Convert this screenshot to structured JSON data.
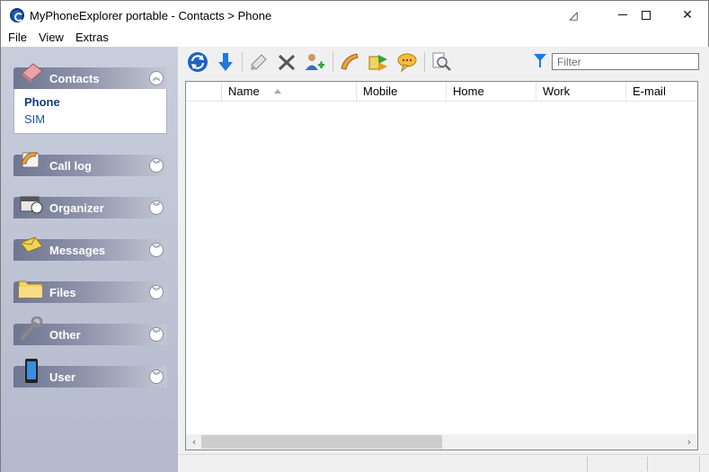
{
  "window": {
    "title": "MyPhoneExplorer portable -  Contacts > Phone"
  },
  "menubar": {
    "items": [
      "File",
      "View",
      "Extras"
    ]
  },
  "sidebar": {
    "groups": [
      {
        "label": "Contacts",
        "icon": "contacts-book-icon",
        "expanded": true,
        "items": [
          {
            "label": "Phone",
            "active": true
          },
          {
            "label": "SIM",
            "active": false
          }
        ]
      },
      {
        "label": "Call log",
        "icon": "phone-handset-icon",
        "expanded": false
      },
      {
        "label": "Organizer",
        "icon": "organizer-icon",
        "expanded": false
      },
      {
        "label": "Messages",
        "icon": "envelope-icon",
        "expanded": false
      },
      {
        "label": "Files",
        "icon": "folder-icon",
        "expanded": false
      },
      {
        "label": "Other",
        "icon": "wrench-icon",
        "expanded": false
      },
      {
        "label": "User",
        "icon": "phone-device-icon",
        "expanded": false
      }
    ]
  },
  "toolbar": {
    "buttons": [
      "refresh-icon",
      "download-icon",
      "edit-icon",
      "delete-icon",
      "add-contact-icon",
      "call-icon",
      "sync-icon",
      "chat-icon",
      "search-icon"
    ],
    "filter_placeholder": "Filter"
  },
  "list": {
    "columns": [
      "",
      "Name",
      "Mobile",
      "Home",
      "Work",
      "E-mail"
    ],
    "sort_column": "Name",
    "sort_direction": "ascending",
    "rows": []
  },
  "colors": {
    "sidebar_bg": "#c0c5d6",
    "accent_blue": "#1a56a8",
    "group_header": "#7b8299"
  }
}
